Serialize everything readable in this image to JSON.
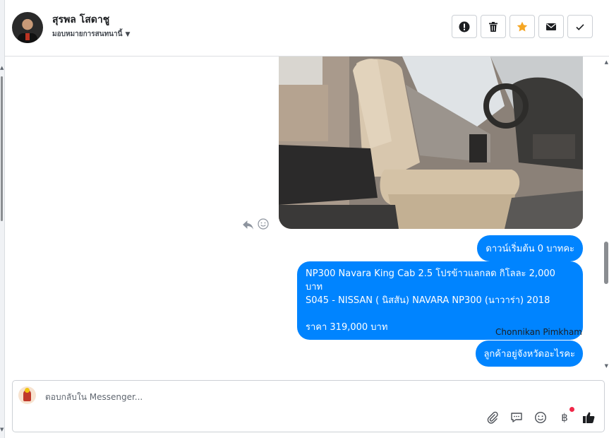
{
  "header": {
    "contact_name": "สุรพล โสดาชู",
    "assign_label": "มอบหมายการสนทนานี้",
    "actions": [
      {
        "name": "mark-spam-button",
        "icon": "alert-icon"
      },
      {
        "name": "delete-button",
        "icon": "trash-icon"
      },
      {
        "name": "star-button",
        "icon": "star-icon"
      },
      {
        "name": "mark-unread-button",
        "icon": "envelope-icon"
      },
      {
        "name": "mark-done-button",
        "icon": "check-icon"
      }
    ]
  },
  "messages": [
    {
      "type": "image",
      "description_icon": "car-interior-photo"
    },
    {
      "type": "text",
      "text": "ดาวน์เริ่มต้น 0 บาทคะ"
    },
    {
      "type": "text",
      "lines": [
        "NP300 Navara King Cab 2.5 โปรข้าวแลกลด กิโลละ 2,000 บาท",
        "S045 - NISSAN ( นิสสัน) NAVARA NP300 (นาวาร่า) 2018",
        "",
        "ราคา 319,000 บาท"
      ]
    },
    {
      "type": "text",
      "sender": "Chonnikan Pimkham",
      "text": "ลูกค้าอยู่จังหวัดอะไรคะ"
    }
  ],
  "composer": {
    "placeholder": "ตอบกลับใน Messenger...",
    "value": "",
    "tools": [
      "paperclip-icon",
      "saved-reply-icon",
      "emoji-icon",
      "baht-icon",
      "thumbs-up-icon"
    ],
    "baht_symbol": "฿"
  },
  "colors": {
    "bubble": "#0084ff",
    "star": "#f5a623",
    "notification": "#f02849"
  }
}
